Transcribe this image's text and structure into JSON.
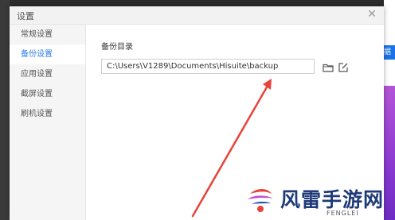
{
  "dialog": {
    "title": "设置",
    "close_icon": "close-icon"
  },
  "sidebar": {
    "items": [
      {
        "label": "常规设置",
        "active": false
      },
      {
        "label": "备份设置",
        "active": true
      },
      {
        "label": "应用设置",
        "active": false
      },
      {
        "label": "截屏设置",
        "active": false
      },
      {
        "label": "刷机设置",
        "active": false
      }
    ]
  },
  "backup": {
    "section_label": "备份目录",
    "path_value": "C:\\Users\\V1289\\Documents\\Hisuite\\backup",
    "folder_icon": "folder-icon",
    "edit_icon": "edit-icon"
  },
  "background": {
    "right_button_label": "据",
    "accent_color": "#1a73e8"
  },
  "annotation": {
    "arrow_color": "#e8433a"
  },
  "watermark": {
    "title": "风雷手游网",
    "subtitle": "FENGLEI"
  }
}
